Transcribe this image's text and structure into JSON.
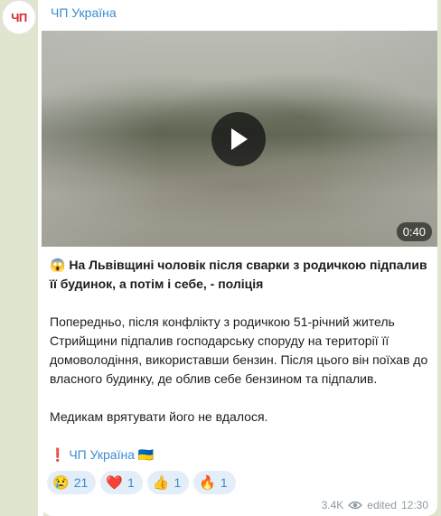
{
  "channel": {
    "avatar_text": "ЧП",
    "name": "ЧП Україна"
  },
  "video": {
    "duration": "0:40"
  },
  "post": {
    "headline_emoji": "😱",
    "headline": "На Львівщині чоловік після сварки з родичкою підпалив її будинок, а потім і себе, - поліція",
    "paragraph1": "Попередньо, після конфлікту з родичкою 51-річний житель Стрийщини підпалив господарську споруду на території її домоволодіння, використавши бензин. Після цього він поїхав до власного будинку, де облив себе бензином та підпалив.",
    "paragraph2": "Медикам врятувати його не вдалося.",
    "source_prefix": "❗",
    "source_name": "ЧП Україна",
    "source_flag": "🇺🇦"
  },
  "reactions": [
    {
      "emoji": "😢",
      "count": "21"
    },
    {
      "emoji": "❤️",
      "count": "1"
    },
    {
      "emoji": "👍",
      "count": "1"
    },
    {
      "emoji": "🔥",
      "count": "1"
    }
  ],
  "meta": {
    "views": "3.4K",
    "edited": "edited",
    "time": "12:30"
  },
  "colors": {
    "accent": "#3a8ccf",
    "avatar_red": "#d9232e",
    "background": "#dfe5cf"
  },
  "icons": {
    "play": "play-icon",
    "views": "eye-icon"
  }
}
